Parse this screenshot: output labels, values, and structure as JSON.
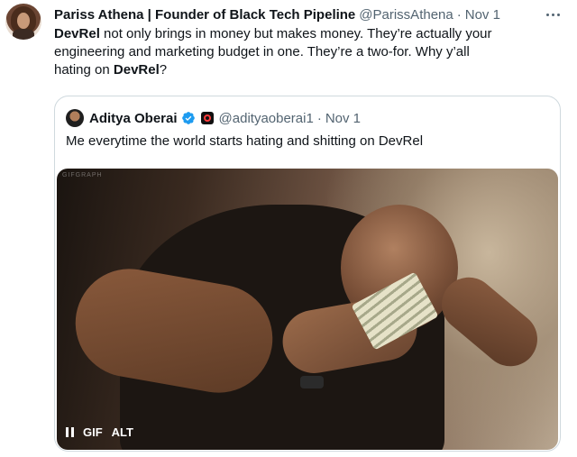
{
  "post": {
    "author_name": "Pariss Athena | Founder of Black Tech Pipeline",
    "author_handle": "@ParissAthena",
    "separator": "·",
    "date": "Nov 1",
    "text": {
      "line1_mention": "DevRel",
      "line1_rest": " not only brings in money but makes money. They’re actually your",
      "line2": "engineering and marketing budget in one. They’re a two-for. Why y’all",
      "line3_before": "hating on ",
      "line3_mention": "DevRel",
      "line3_after": "?"
    }
  },
  "quoted_post": {
    "author_name": "Aditya Oberai",
    "author_handle": "@adityaoberai1",
    "separator": "·",
    "date": "Nov 1",
    "text": "Me everytime the world starts hating and shitting on DevRel",
    "media": {
      "watermark": "GIFGRAPH",
      "gif_label": "GIF",
      "alt_label": "ALT"
    }
  },
  "colors": {
    "text_primary": "#0f1419",
    "text_secondary": "#536471",
    "border": "#cfd9de",
    "verified": "#1d9bf0"
  },
  "icons": [
    "more-icon",
    "verified-icon",
    "affiliate-icon",
    "pause-icon"
  ]
}
